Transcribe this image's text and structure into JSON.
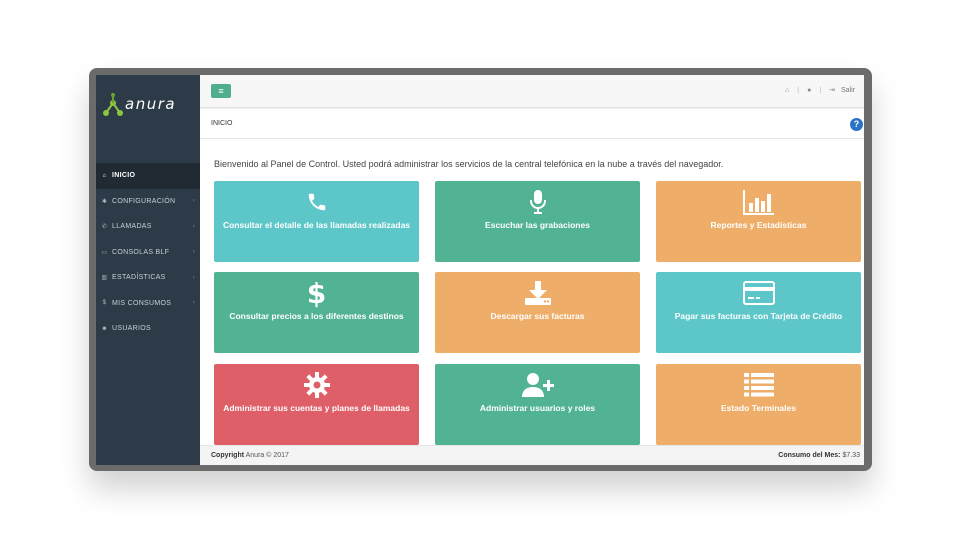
{
  "brand": {
    "name": "anura"
  },
  "sidebar": {
    "items": [
      {
        "label": "INICIO",
        "icon": "home-icon",
        "glyph": "⌂",
        "active": true,
        "has_children": false
      },
      {
        "label": "CONFIGURACIÓN",
        "icon": "gear-icon",
        "glyph": "✱",
        "active": false,
        "has_children": true
      },
      {
        "label": "LLAMADAS",
        "icon": "phone-icon",
        "glyph": "✆",
        "active": false,
        "has_children": true
      },
      {
        "label": "CONSOLAS BLF",
        "icon": "console-icon",
        "glyph": "▭",
        "active": false,
        "has_children": true
      },
      {
        "label": "ESTADÍSTICAS",
        "icon": "bar-chart-icon",
        "glyph": "▥",
        "active": false,
        "has_children": true
      },
      {
        "label": "MIS CONSUMOS",
        "icon": "dollar-icon",
        "glyph": "$",
        "active": false,
        "has_children": true
      },
      {
        "label": "USUARIOS",
        "icon": "users-icon",
        "glyph": "☻",
        "active": false,
        "has_children": false
      }
    ],
    "chevron": "‹"
  },
  "topbar": {
    "menu_glyph": "≡",
    "home_glyph": "⌂",
    "user_glyph": "●",
    "separator": "|",
    "logout_glyph": "⇥",
    "logout_label": "Salir"
  },
  "breadcrumb": {
    "current": "INICIO",
    "help_glyph": "?"
  },
  "welcome_text": "Bienvenido al Panel de Control. Usted podrá administrar los servicios de la central telefónica en la nube a través del navegador.",
  "tiles": [
    {
      "label": "Consultar el detalle de las llamadas realizadas",
      "icon": "phone-icon",
      "color": "#5cc6c9"
    },
    {
      "label": "Escuchar las grabaciones",
      "icon": "microphone-icon",
      "color": "#52b294"
    },
    {
      "label": "Reportes y Estadísticas",
      "icon": "bar-chart-icon",
      "color": "#eeae69"
    },
    {
      "label": "Consultar precios a los diferentes destinos",
      "icon": "dollar-icon",
      "color": "#52b294"
    },
    {
      "label": "Descargar sus facturas",
      "icon": "download-icon",
      "color": "#eeae69"
    },
    {
      "label": "Pagar sus facturas con Tarjeta de Crédito",
      "icon": "credit-card-icon",
      "color": "#5cc6c9"
    },
    {
      "label": "Administrar sus cuentas y planes de llamadas",
      "icon": "gear-icon",
      "color": "#de5f67"
    },
    {
      "label": "Administrar usuarios y roles",
      "icon": "add-user-icon",
      "color": "#52b294"
    },
    {
      "label": "Estado Terminales",
      "icon": "list-icon",
      "color": "#eeae69"
    }
  ],
  "footer": {
    "copyright_label": "Copyright",
    "copyright_text": "Anura © 2017",
    "consumption_label": "Consumo del Mes:",
    "consumption_value": "$7.33"
  }
}
